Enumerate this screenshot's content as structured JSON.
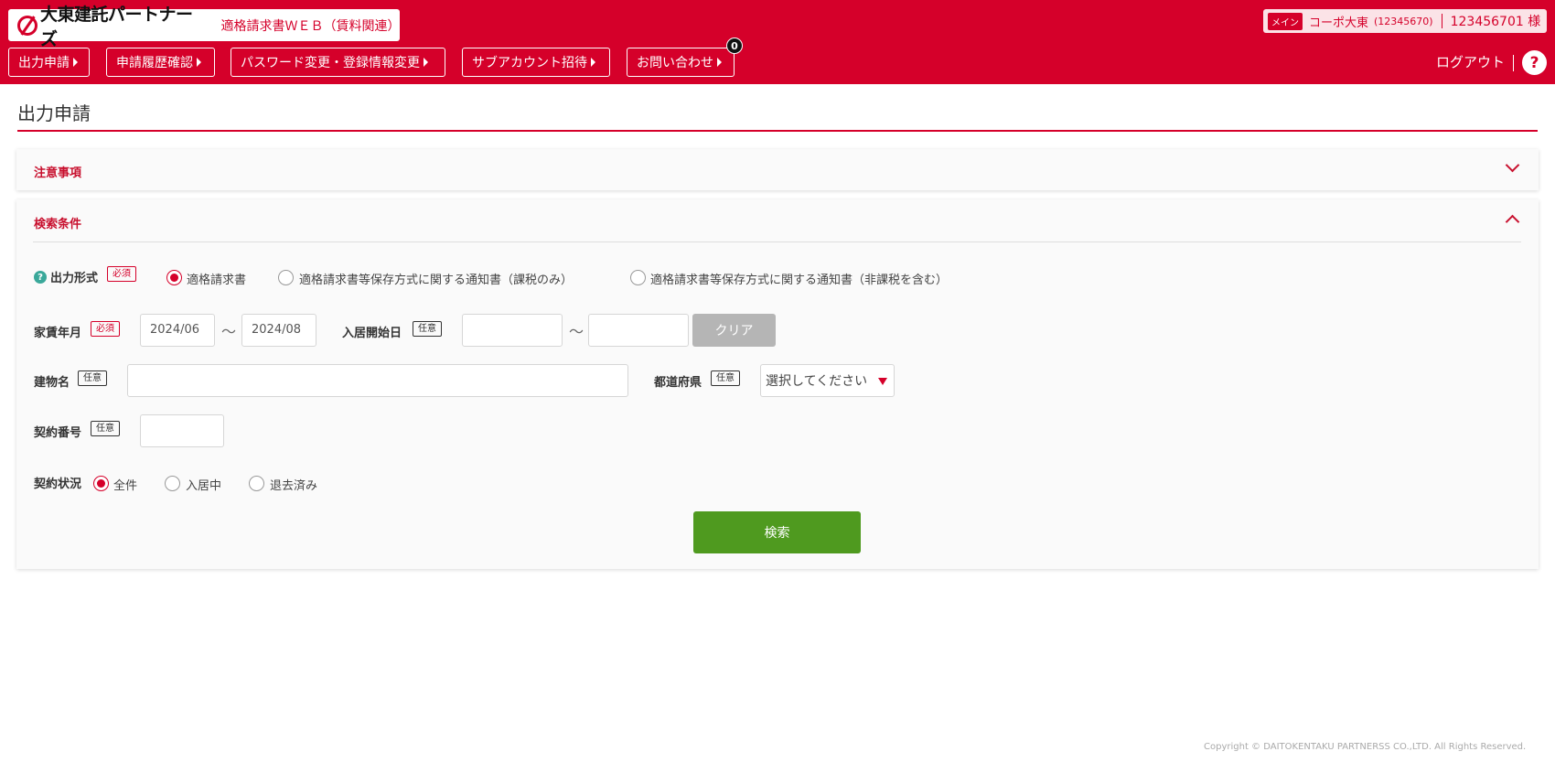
{
  "header": {
    "brand_name": "大東建託パートナーズ",
    "brand_sub": "適格請求書ＷＥＢ（賃料関連）",
    "nav": [
      {
        "label": "出力申請"
      },
      {
        "label": "申請履歴確認"
      },
      {
        "label": "パスワード変更・登録情報変更"
      },
      {
        "label": "サブアカウント招待"
      },
      {
        "label": "お問い合わせ"
      }
    ],
    "inquiry_badge": "0",
    "user": {
      "tag": "メイン",
      "name": "コーポ大東",
      "name_id": "(12345670)",
      "account": "123456701 様"
    },
    "logout_label": "ログアウト",
    "help_label": "?"
  },
  "page": {
    "title": "出力申請"
  },
  "notice_panel": {
    "title": "注意事項"
  },
  "search_panel": {
    "title": "検索条件",
    "output_format": {
      "label": "出力形式",
      "tag": "必須",
      "options": [
        "適格請求書",
        "適格請求書等保存方式に関する通知書（課税のみ）",
        "適格請求書等保存方式に関する通知書（非課税を含む）"
      ],
      "selected": "適格請求書"
    },
    "rent_month": {
      "label": "家賃年月",
      "tag": "必須",
      "from": "2024/06",
      "to": "2024/08",
      "separator": "〜"
    },
    "move_in_date": {
      "label": "入居開始日",
      "tag": "任意",
      "from": "",
      "to": "",
      "separator": "〜",
      "clear_label": "クリア"
    },
    "building_name": {
      "label": "建物名",
      "tag": "任意",
      "value": ""
    },
    "prefecture": {
      "label": "都道府県",
      "tag": "任意",
      "selected": "選択してください"
    },
    "contract_number": {
      "label": "契約番号",
      "tag": "任意",
      "value": ""
    },
    "contract_status": {
      "label": "契約状況",
      "options": [
        "全件",
        "入居中",
        "退去済み"
      ],
      "selected": "全件"
    },
    "search_label": "検索"
  },
  "footer": {
    "copyright": "Copyright © DAITOKENTAKU PARTNERSS CO.,LTD. All Rights Reserved."
  },
  "colors": {
    "brand_red": "#d5002a",
    "search_green": "#4f9a1f",
    "clear_gray": "#b5b5b5"
  }
}
